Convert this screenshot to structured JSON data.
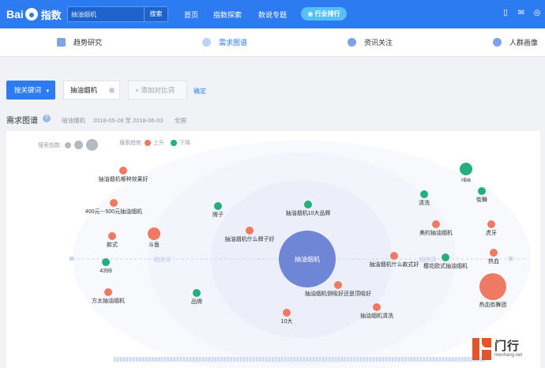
{
  "topbar": {
    "logo_text": "Bai",
    "logo_suffix": "指数",
    "search_value": "抽油烟机",
    "search_button": "搜索",
    "nav": [
      "首页",
      "指数探索",
      "数说专题"
    ],
    "rank_button": "行业排行"
  },
  "subnav": {
    "items": [
      "趋势研究",
      "需求图谱",
      "资讯关注",
      "人群画像"
    ],
    "active": "需求图谱"
  },
  "filter": {
    "keyword_select": "按关键词",
    "keyword": "抽油烟机",
    "add_compare": "+ 添加对比词",
    "confirm": "确定"
  },
  "chart_header": {
    "title": "需求图谱",
    "keyword": "抽油烟机",
    "date_range": "2018-05-28 至 2018-06-03",
    "region": "全国"
  },
  "legend": {
    "search_index_label": "搜索指数:",
    "trend_label": "搜索趋势",
    "up": "上升",
    "down": "下降"
  },
  "colors": {
    "up": "#ee7a63",
    "down": "#23b07d",
    "center": "#6f86d6",
    "accent": "#2d7bf0"
  },
  "chart_data": {
    "type": "scatter",
    "center": "抽油烟机",
    "axis_labels": [
      "相关词",
      "相关词"
    ],
    "nodes": [
      {
        "label": "抽油烟机哪种效果好",
        "trend": "up",
        "size": "small"
      },
      {
        "label": "400元---500元抽油烟机",
        "trend": "up",
        "size": "small"
      },
      {
        "label": "款式",
        "trend": "up",
        "size": "small"
      },
      {
        "label": "4399",
        "trend": "down",
        "size": "small"
      },
      {
        "label": "方太抽油烟机",
        "trend": "up",
        "size": "small"
      },
      {
        "label": "斗鱼",
        "trend": "up",
        "size": "medium"
      },
      {
        "label": "牌子",
        "trend": "down",
        "size": "small"
      },
      {
        "label": "抽油烟机什么牌子好",
        "trend": "up",
        "size": "small"
      },
      {
        "label": "品牌",
        "trend": "down",
        "size": "small"
      },
      {
        "label": "抽油烟机10大品牌",
        "trend": "down",
        "size": "small"
      },
      {
        "label": "抽油烟机侧吸好还是顶吸好",
        "trend": "up",
        "size": "small"
      },
      {
        "label": "10大",
        "trend": "up",
        "size": "small"
      },
      {
        "label": "抽油烟机清洗",
        "trend": "up",
        "size": "small"
      },
      {
        "label": "抽油烟机什么款式好",
        "trend": "up",
        "size": "small"
      },
      {
        "label": "清洗",
        "trend": "down",
        "size": "small"
      },
      {
        "label": "美的抽油烟机",
        "trend": "up",
        "size": "small"
      },
      {
        "label": "樱花欧式抽油烟机",
        "trend": "down",
        "size": "small"
      },
      {
        "label": "nba",
        "trend": "down",
        "size": "medium"
      },
      {
        "label": "街舞",
        "trend": "down",
        "size": "small"
      },
      {
        "label": "虎牙",
        "trend": "up",
        "size": "small"
      },
      {
        "label": "热血",
        "trend": "up",
        "size": "small"
      },
      {
        "label": "热血街舞团",
        "trend": "up",
        "size": "large"
      }
    ]
  },
  "watermark": {
    "cn": "门行",
    "en": "menhang.net"
  }
}
